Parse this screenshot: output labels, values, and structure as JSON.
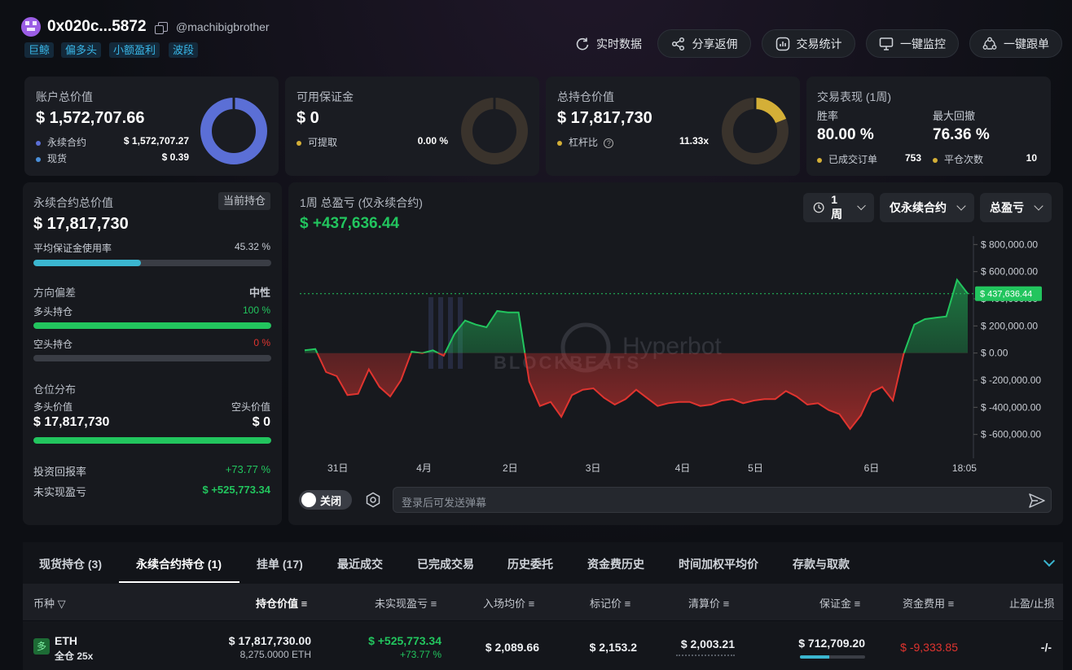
{
  "header": {
    "address": "0x020c...5872",
    "handle": "@machibigbrother",
    "tags": [
      "巨鲸",
      "偏多头",
      "小额盈利",
      "波段"
    ],
    "buttons": {
      "realtime": "实时数据",
      "share": "分享返佣",
      "stats": "交易统计",
      "monitor": "一键监控",
      "copytrade": "一键跟单"
    }
  },
  "account": {
    "label": "账户总价值",
    "value": "$ 1,572,707.66",
    "perp_label": "永续合约",
    "perp_value": "$ 1,572,707.27",
    "spot_label": "现货",
    "spot_value": "$ 0.39",
    "donut_perp_fraction": 0.9999
  },
  "margin": {
    "label": "可用保证金",
    "value": "$ 0",
    "withdraw_label": "可提取",
    "withdraw_value": "0.00 %",
    "donut_fraction": 0
  },
  "position_value": {
    "label": "总持仓价值",
    "value": "$ 17,817,730",
    "leverage_label": "杠杆比",
    "leverage_value": "11.33x",
    "donut_fraction": 0.19
  },
  "performance": {
    "label": "交易表现 (1周)",
    "winrate_label": "胜率",
    "winrate_value": "80.00 %",
    "drawdown_label": "最大回撤",
    "drawdown_value": "76.36 %",
    "orders_label": "已成交订单",
    "orders_value": "753",
    "closes_label": "平仓次数",
    "closes_value": "10"
  },
  "perp_panel": {
    "title": "永续合约总价值",
    "badge": "当前持仓",
    "value": "$ 17,817,730",
    "margin_usage_label": "平均保证金使用率",
    "margin_usage_value": "45.32 %",
    "margin_usage_fraction": 0.4532,
    "direction_label": "方向偏差",
    "direction_value": "中性",
    "long_label": "多头持仓",
    "long_value": "100 %",
    "long_fraction": 1.0,
    "short_label": "空头持仓",
    "short_value": "0 %",
    "short_fraction": 0,
    "dist_label": "仓位分布",
    "long_val_label": "多头价值",
    "short_val_label": "空头价值",
    "long_val": "$ 17,817,730",
    "short_val": "$ 0",
    "roi_label": "投资回报率",
    "roi_value": "+73.77 %",
    "upnl_label": "未实现盈亏",
    "upnl_value": "$ +525,773.34"
  },
  "pnl_chart": {
    "title": "1周 总盈亏 (仅永续合约)",
    "value": "$ +437,636.44",
    "dropdowns": [
      "1周",
      "仅永续合约",
      "总盈亏"
    ],
    "current_label": "$ 437,636.44",
    "watermark_left": "BLOCKBEATS",
    "watermark_right": "Hyperbot",
    "toggle_label": "关闭",
    "danmaku_placeholder": "登录后可发送弹幕"
  },
  "chart_data": {
    "type": "area",
    "title": "1周 总盈亏 (仅永续合约)",
    "x_ticks": [
      "31日",
      "4月",
      "2日",
      "3日",
      "4日",
      "5日",
      "6日",
      "18:05"
    ],
    "y_ticks": [
      "$ 800,000.00",
      "$ 600,000.00",
      "$ 400,000.00",
      "$ 200,000.00",
      "$ 0.00",
      "$ -200,000.00",
      "$ -400,000.00",
      "$ -600,000.00"
    ],
    "ylim": [
      -620000,
      820000
    ],
    "baseline": 0,
    "values": [
      20000,
      30000,
      -140000,
      -170000,
      -310000,
      -300000,
      -120000,
      -250000,
      -320000,
      -200000,
      10000,
      0,
      20000,
      -20000,
      140000,
      240000,
      210000,
      190000,
      310000,
      300000,
      300000,
      -210000,
      -390000,
      -360000,
      -470000,
      -310000,
      -270000,
      -260000,
      -330000,
      -380000,
      -340000,
      -270000,
      -330000,
      -390000,
      -370000,
      -360000,
      -360000,
      -390000,
      -380000,
      -350000,
      -340000,
      -370000,
      -350000,
      -340000,
      -340000,
      -280000,
      -320000,
      -380000,
      -370000,
      -420000,
      -450000,
      -560000,
      -460000,
      -290000,
      -250000,
      -350000,
      -10000,
      210000,
      250000,
      260000,
      270000,
      540000,
      437636
    ],
    "current_value": 437636.44,
    "grid": false
  },
  "bottom_tabs": [
    "现货持仓 (3)",
    "永续合约持仓 (1)",
    "挂单 (17)",
    "最近成交",
    "已完成交易",
    "历史委托",
    "资金费历史",
    "时间加权平均价",
    "存款与取款"
  ],
  "table": {
    "headers": [
      "币种",
      "持仓价值",
      "未实现盈亏",
      "入场均价",
      "标记价",
      "清算价",
      "保证金",
      "资金费用",
      "止盈/止损"
    ],
    "row": {
      "side": "多",
      "coin": "ETH",
      "mode": "全仓 25x",
      "position_value": "$ 17,817,730.00",
      "position_size": "8,275.0000 ETH",
      "upnl": "$ +525,773.34",
      "upnl_pct": "+73.77 %",
      "entry": "$ 2,089.66",
      "mark": "$ 2,153.2",
      "liq": "$ 2,003.21",
      "margin": "$ 712,709.20",
      "margin_fraction": 0.45,
      "funding": "$ -9,333.85",
      "tpsl": "-/-"
    }
  },
  "colors": {
    "green": "#22c55e",
    "red": "#e0342f",
    "blue_donut": "#5b6fd6",
    "gold": "#d4af37",
    "cyan": "#3bb6d0"
  }
}
